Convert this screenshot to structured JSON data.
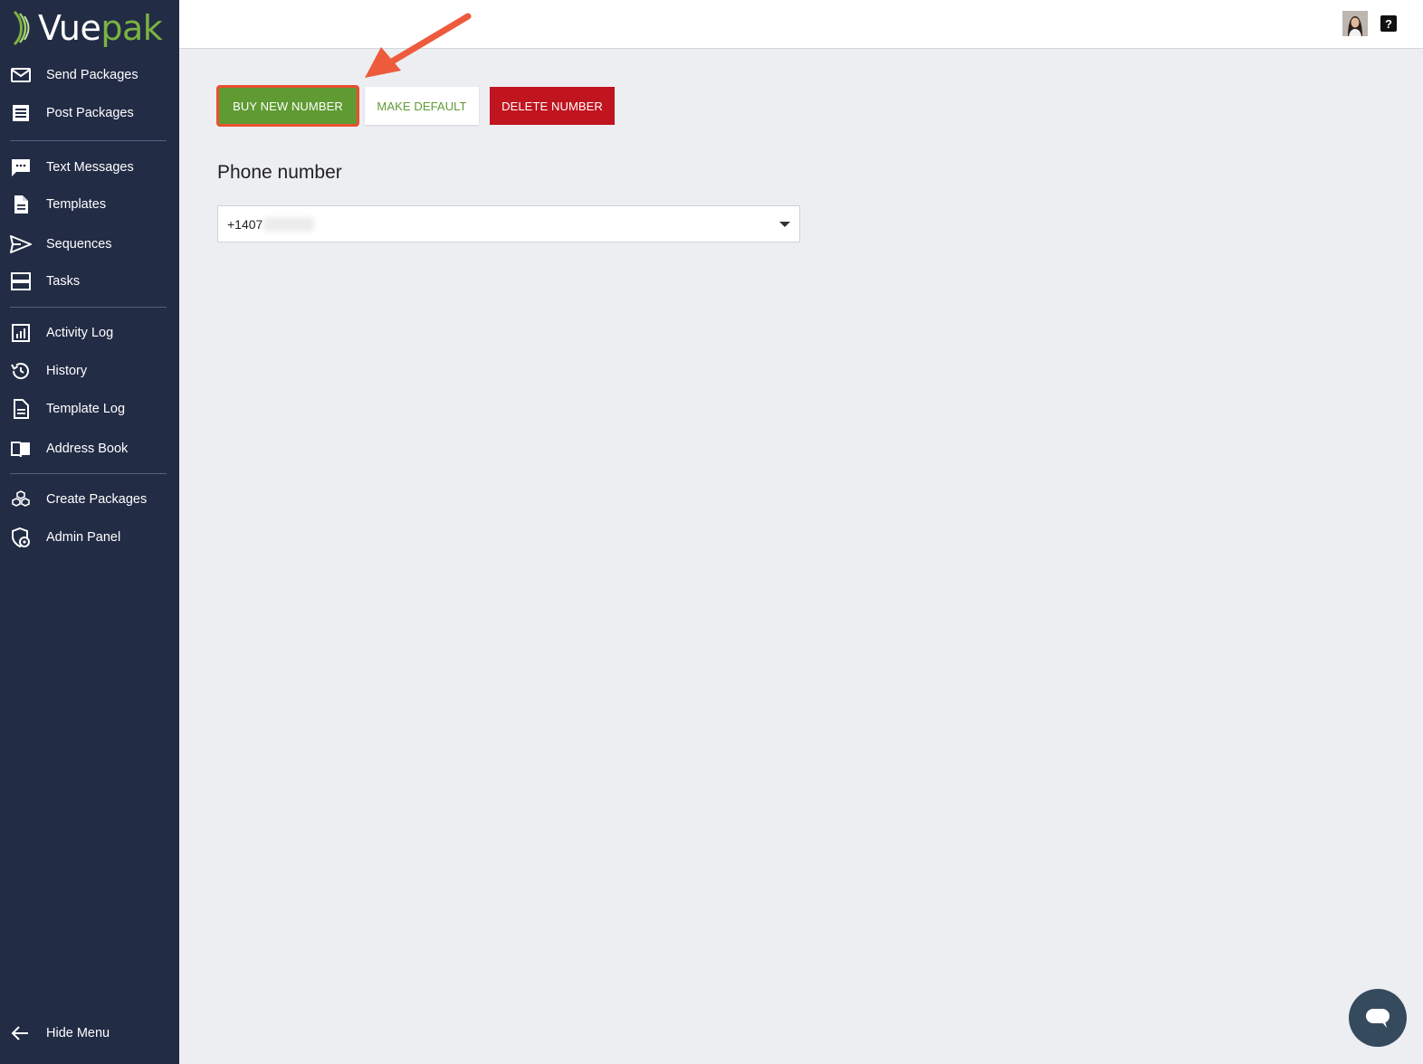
{
  "brand": {
    "name_part1": "Vue",
    "name_part2": "pak",
    "accent": "#7bb341"
  },
  "sidebar": {
    "items": [
      {
        "label": "Send Packages",
        "icon": "envelope-icon"
      },
      {
        "label": "Post Packages",
        "icon": "inbox-icon"
      },
      {
        "label": "Text Messages",
        "icon": "chat-bubble-icon"
      },
      {
        "label": "Templates",
        "icon": "document-icon"
      },
      {
        "label": "Sequences",
        "icon": "send-icon"
      },
      {
        "label": "Tasks",
        "icon": "stack-icon"
      },
      {
        "label": "Activity Log",
        "icon": "bar-chart-icon"
      },
      {
        "label": "History",
        "icon": "history-icon"
      },
      {
        "label": "Template Log",
        "icon": "document-lines-icon"
      },
      {
        "label": "Address Book",
        "icon": "book-icon"
      },
      {
        "label": "Create Packages",
        "icon": "boxes-icon"
      },
      {
        "label": "Admin Panel",
        "icon": "shield-gear-icon"
      }
    ],
    "hide_menu": {
      "label": "Hide Menu",
      "icon": "arrow-left-icon"
    }
  },
  "topbar": {
    "help_label": "?"
  },
  "actions": {
    "buy_label": "BUY NEW NUMBER",
    "default_label": "MAKE DEFAULT",
    "delete_label": "DELETE NUMBER"
  },
  "phone": {
    "title": "Phone number",
    "selected_value": "+1407"
  },
  "colors": {
    "sidebar_bg": "#232c45",
    "primary_green": "#5f9a33",
    "danger_red": "#c0141f",
    "highlight": "#e8502f"
  }
}
